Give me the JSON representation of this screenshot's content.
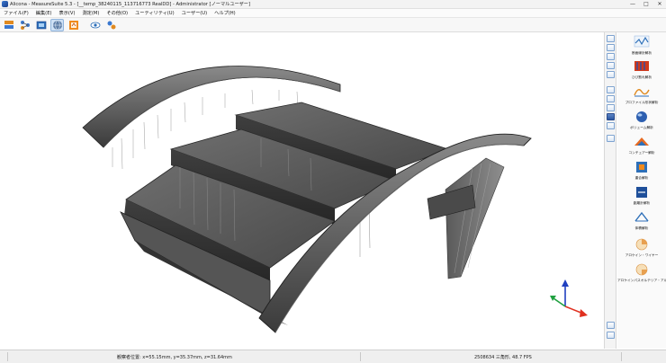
{
  "window": {
    "title": "Alicona - MeasureSuite 5.3 - [__temp_38240115_113716773 RealDD] - Administrator [ノーマルユーザー]",
    "controls": [
      "—",
      "□",
      "✕"
    ]
  },
  "menu": [
    {
      "label": "ファイル(F)"
    },
    {
      "label": "編集(E)"
    },
    {
      "label": "表示(V)"
    },
    {
      "label": "測定(M)"
    },
    {
      "label": "その他(O)"
    },
    {
      "label": "ユーティリティ(U)"
    },
    {
      "label": "ユーザー(U)"
    },
    {
      "label": "ヘルプ(H)"
    }
  ],
  "analysis_tools": [
    {
      "label": "断面線計解析",
      "icon": "profile-graph-icon"
    },
    {
      "label": "ひび割れ解析",
      "icon": "crack-analysis-icon"
    },
    {
      "label": "プロファイル形状解析",
      "icon": "profile-form-icon"
    },
    {
      "label": "ボリューム解析",
      "icon": "volume-sphere-icon"
    },
    {
      "label": "コンチュアー解析",
      "icon": "contour-icon"
    },
    {
      "label": "重合解析",
      "icon": "overlay-icon"
    },
    {
      "label": "距離計解析",
      "icon": "distance-icon"
    },
    {
      "label": "体積解析",
      "icon": "volume-icon"
    },
    {
      "label": "アロケイン・ワイヤー",
      "icon": "wire-pie-icon"
    },
    {
      "label": "アロケインパスオルテリア・アル",
      "icon": "wire-pie-2-icon"
    }
  ],
  "status": {
    "position": "観察者位置: x=55.15mm, y=35.37mm, z=31.64mm",
    "render_info": "2508634 三角形, 48.7 FPS"
  },
  "colors": {
    "accent": "#3a78d0",
    "axis_x": "#e03020",
    "axis_y": "#20a040",
    "axis_z": "#2040c0"
  }
}
